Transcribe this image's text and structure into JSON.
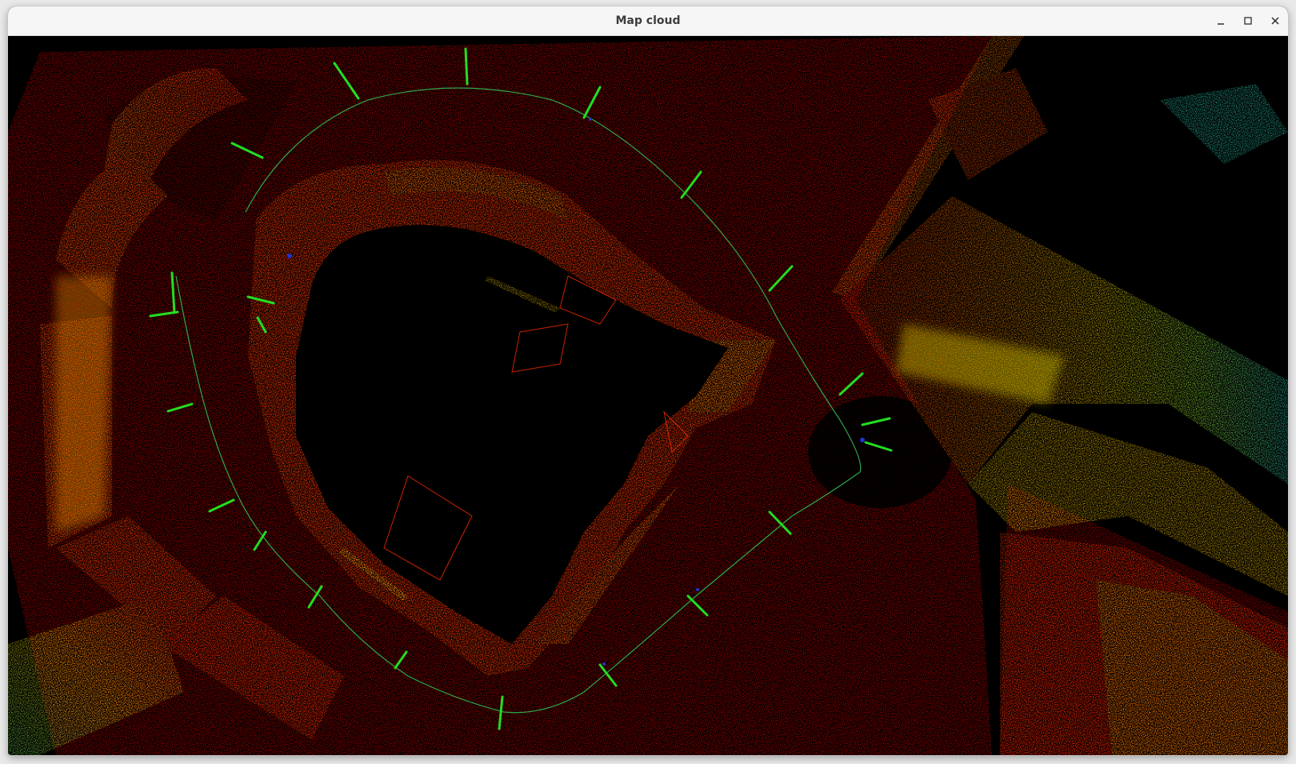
{
  "window": {
    "title": "Map cloud",
    "buttons": [
      {
        "name": "minimize-button",
        "icon": "minimize-icon"
      },
      {
        "name": "maximize-button",
        "icon": "maximize-icon"
      },
      {
        "name": "close-button",
        "icon": "close-icon"
      }
    ]
  },
  "viewer": {
    "background": "#000000",
    "colormap": [
      "#ff0000",
      "#ff6a00",
      "#ffd000",
      "#aaff33",
      "#33ddbb"
    ],
    "trajectory_color": "#2fa84a",
    "pose_axis_color": "#22dd22",
    "pose_origin_color": "#2233cc"
  }
}
